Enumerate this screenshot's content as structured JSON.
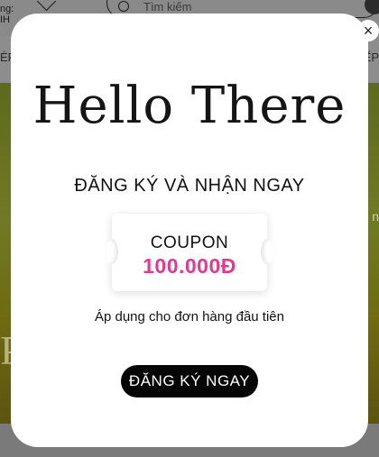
{
  "background": {
    "header_label": "...ng:\nIH",
    "search_placeholder": "Tìm kiếm",
    "nav_left": "ÉP",
    "nav_right": "ẾP"
  },
  "popup": {
    "title": "Hello There",
    "subtitle": "ĐĂNG KÝ VÀ NHẬN NGAY",
    "coupon_label": "COUPON",
    "coupon_amount": "100.000Đ",
    "note": "Áp dụng cho đơn hàng đầu tiên",
    "cta_label": "ĐĂNG KÝ NGAY"
  },
  "colors": {
    "accent": "#e23a8e",
    "cta_bg": "#050505"
  },
  "icons": {
    "close": "close-icon",
    "search": "search-icon",
    "heart": "heart-icon"
  }
}
